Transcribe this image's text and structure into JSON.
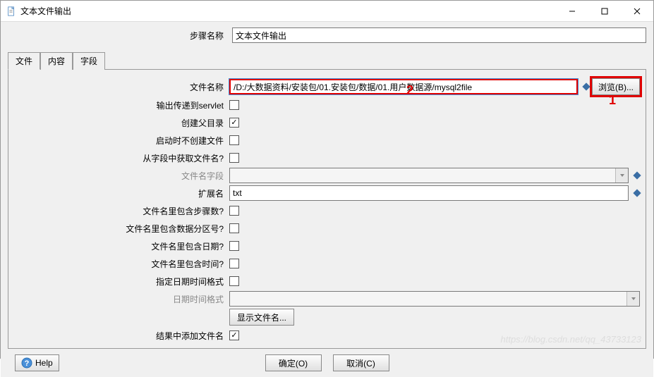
{
  "title": "文本文件输出",
  "step_name_label": "步骤名称",
  "step_name_value": "文本文件输出",
  "tabs": {
    "file": "文件",
    "content": "内容",
    "fields": "字段"
  },
  "form": {
    "file_name_label": "文件名称",
    "file_name_value": "/D:/大数据资料/安装包/01.安装包/数据/01.用户数据源/mysql2file",
    "browse_label": "浏览(B)...",
    "output_servlet_label": "输出传递到servlet",
    "create_parent_label": "创建父目录",
    "no_create_on_start_label": "启动时不创建文件",
    "filename_from_field_label": "从字段中获取文件名?",
    "filename_field_label": "文件名字段",
    "extension_label": "扩展名",
    "extension_value": "txt",
    "include_step_label": "文件名里包含步骤数?",
    "include_partition_label": "文件名里包含数据分区号?",
    "include_date_label": "文件名里包含日期?",
    "include_time_label": "文件名里包含时间?",
    "specify_format_label": "指定日期时间格式",
    "datetime_format_label": "日期时间格式",
    "show_filenames_label": "显示文件名...",
    "add_filenames_to_result_label": "结果中添加文件名"
  },
  "buttons": {
    "help": "Help",
    "ok": "确定(O)",
    "cancel": "取消(C)"
  },
  "watermark": "https://blog.csdn.net/qq_43733123",
  "annotations": {
    "one": "1",
    "two": "2"
  }
}
